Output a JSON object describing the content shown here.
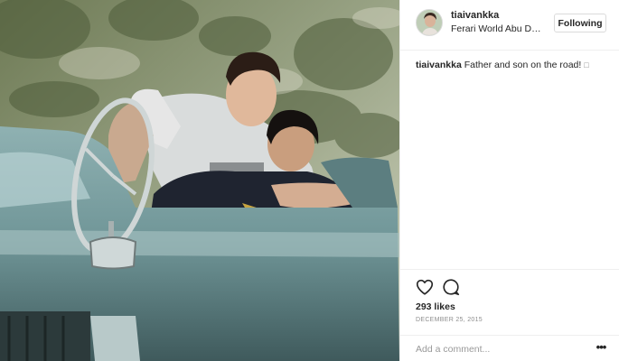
{
  "post": {
    "username": "tiaivankka",
    "location": "Ferari World Abu Dh...",
    "follow_label": "Following",
    "caption": {
      "username": "tiaivankka",
      "text": " Father and son on the road! ",
      "emoji": "□"
    },
    "likes": "293 likes",
    "date": "DECEMBER 25, 2015",
    "comment_placeholder": "Add a comment...",
    "more_label": "•••"
  },
  "icons": {
    "like": "heart-outline-icon",
    "comment": "speech-bubble-icon",
    "more": "more-options-icon"
  },
  "colors": {
    "text": "#262626",
    "secondary": "#8e8e8e",
    "border": "#efefef",
    "car": "#6f9597"
  }
}
